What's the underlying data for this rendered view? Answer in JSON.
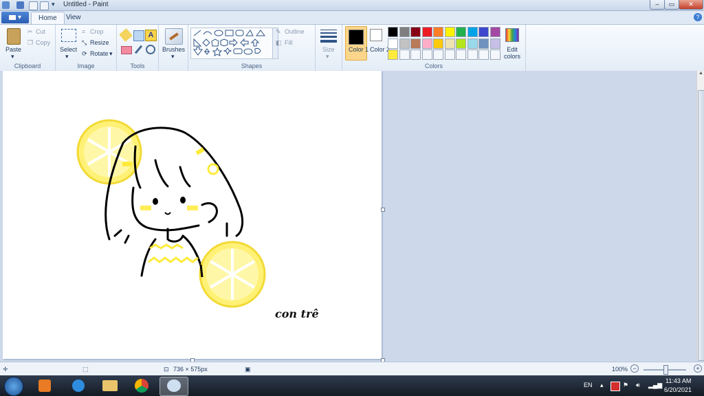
{
  "window": {
    "title": "Untitled - Paint",
    "controls": {
      "minimize": "–",
      "maximize": "▭",
      "close": "✕"
    }
  },
  "menu": {
    "file_label": "▾",
    "help": "?"
  },
  "tabs": [
    {
      "label": "Home",
      "active": true
    },
    {
      "label": "View",
      "active": false
    }
  ],
  "ribbon": {
    "clipboard": {
      "group": "Clipboard",
      "paste": "Paste",
      "cut": "Cut",
      "copy": "Copy"
    },
    "image": {
      "group": "Image",
      "select": "Select",
      "crop": "Crop",
      "resize": "Resize",
      "rotate": "Rotate"
    },
    "tools": {
      "group": "Tools"
    },
    "brushes": {
      "label": "Brushes"
    },
    "shapes": {
      "group": "Shapes",
      "outline": "Outline",
      "fill": "Fill"
    },
    "size": {
      "label": "Size"
    },
    "colors": {
      "group": "Colors",
      "color1": "Color 1",
      "color2": "Color 2",
      "edit": "Edit colors",
      "color1_value": "#000000",
      "color2_value": "#ffffff",
      "palette_row1": [
        "#000000",
        "#7f7f7f",
        "#880015",
        "#ed1c24",
        "#ff7f27",
        "#fff200",
        "#22b14c",
        "#00a2e8",
        "#3f48cc",
        "#a349a4"
      ],
      "palette_row2": [
        "#ffffff",
        "#c3c3c3",
        "#b97a57",
        "#ffaec9",
        "#ffc90e",
        "#efe4b0",
        "#b5e61d",
        "#99d9ea",
        "#7092be",
        "#c8bfe7"
      ],
      "palette_row3": [
        "#ffeb3b",
        "",
        "",
        "",
        "",
        "",
        "",
        "",
        "",
        ""
      ]
    }
  },
  "canvas": {
    "signature": "con trê"
  },
  "status": {
    "dimensions": "736 × 575px",
    "zoom": "100%"
  },
  "taskbar": {
    "language": "EN",
    "time": "11:43 AM",
    "date": "6/20/2021"
  }
}
